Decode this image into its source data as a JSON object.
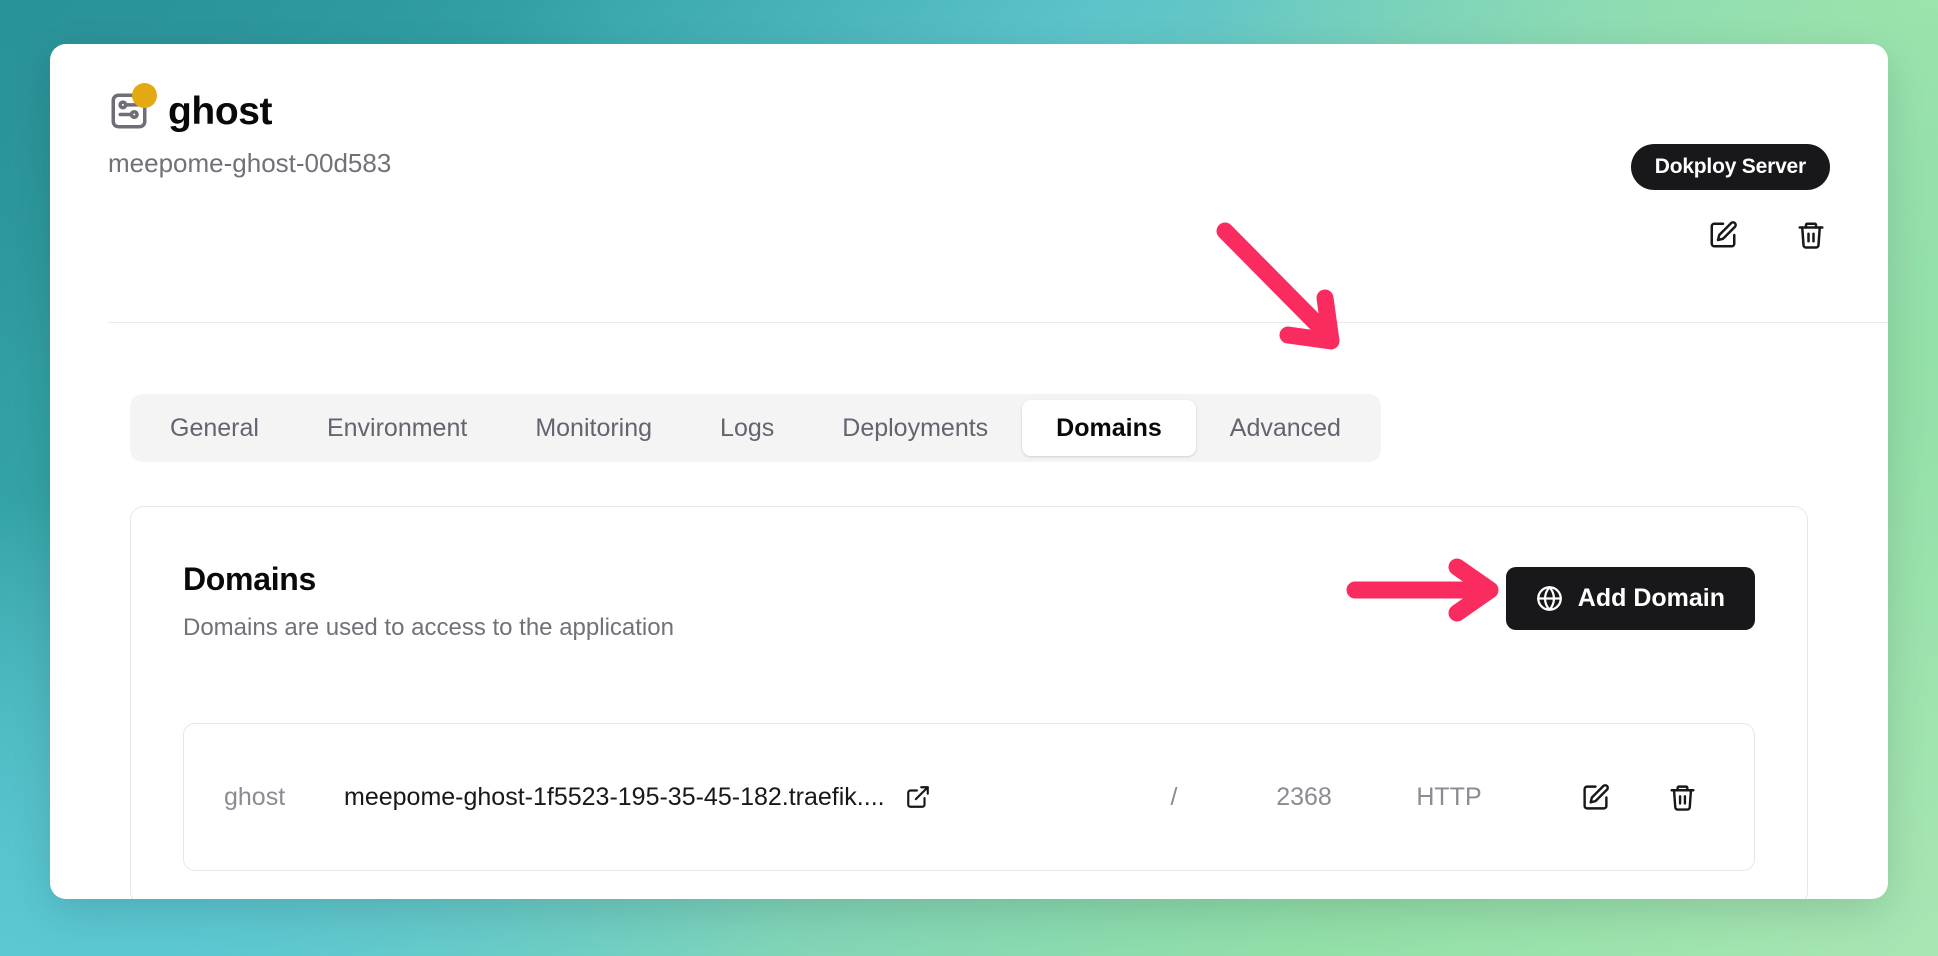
{
  "header": {
    "app_title": "ghost",
    "app_subtitle": "meepome-ghost-00d583",
    "server_badge": "Dokploy Server",
    "edit_icon": "square-pen-icon",
    "delete_icon": "trash-icon",
    "status_dot_color": "#e3a812",
    "app_icon": "server-settings-icon"
  },
  "tabs": [
    {
      "label": "General",
      "active": false
    },
    {
      "label": "Environment",
      "active": false
    },
    {
      "label": "Monitoring",
      "active": false
    },
    {
      "label": "Logs",
      "active": false
    },
    {
      "label": "Deployments",
      "active": false
    },
    {
      "label": "Domains",
      "active": true
    },
    {
      "label": "Advanced",
      "active": false
    }
  ],
  "domains_panel": {
    "title": "Domains",
    "description": "Domains are used to access to the application",
    "add_button": {
      "label": "Add Domain",
      "icon": "globe-icon"
    },
    "rows": [
      {
        "name": "ghost",
        "host": "meepome-ghost-1f5523-195-35-45-182.traefik....",
        "external_link_icon": "external-link-icon",
        "path": "/",
        "port": "2368",
        "protocol": "HTTP",
        "edit_icon": "square-pen-icon",
        "delete_icon": "trash-icon"
      }
    ]
  },
  "annotations": {
    "arrow_color": "#fa2b5e",
    "arrow_to_domains_tab": "arrow-pointing-to-domains-tab",
    "arrow_to_add_domain": "arrow-pointing-to-add-domain-button"
  },
  "theme": {
    "accent_dark": "#18181b",
    "muted_text": "#71717a",
    "border": "#e7e7ea",
    "tab_bar_bg": "#f4f4f5",
    "bg_gradient_from": "#2a9399",
    "bg_gradient_to": "#92dfa8"
  }
}
